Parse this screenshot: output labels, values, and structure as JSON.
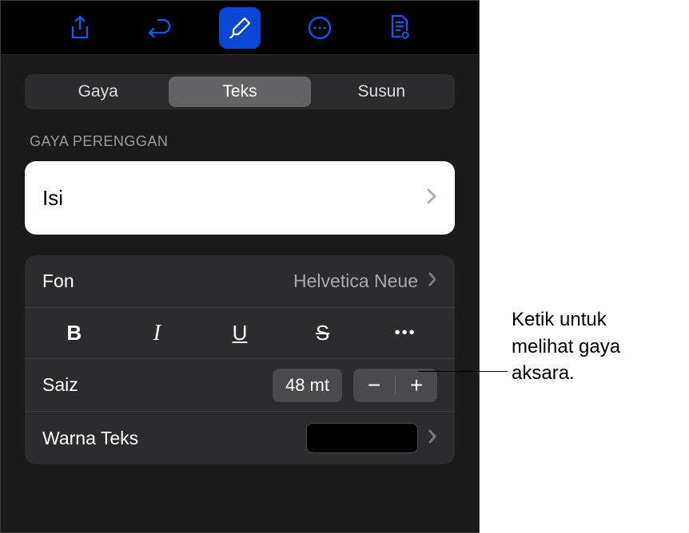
{
  "toolbar": {
    "icons": [
      "share",
      "undo",
      "format",
      "more",
      "document"
    ]
  },
  "tabs": {
    "items": [
      "Gaya",
      "Teks",
      "Susun"
    ],
    "active": 1
  },
  "sectionLabel": "GAYA PERENGGAN",
  "paragraphStyle": {
    "label": "Isi"
  },
  "font": {
    "label": "Fon",
    "value": "Helvetica Neue"
  },
  "styleButtons": {
    "bold": "B",
    "italic": "I",
    "underline": "U",
    "strike": "S",
    "more": "•••"
  },
  "size": {
    "label": "Saiz",
    "value": "48 mt"
  },
  "textColor": {
    "label": "Warna Teks",
    "value": "#000000"
  },
  "callout": {
    "text": "Ketik untuk melihat gaya aksara."
  }
}
